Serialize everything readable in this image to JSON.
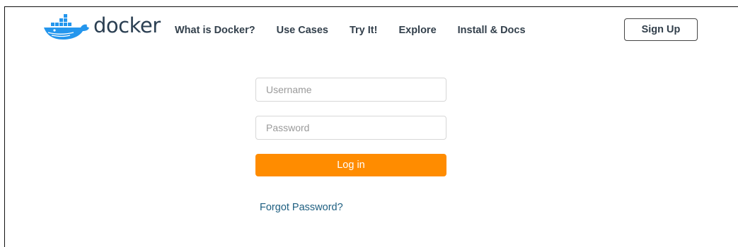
{
  "header": {
    "logo_text": "docker",
    "nav": [
      {
        "label": "What is Docker?"
      },
      {
        "label": "Use Cases"
      },
      {
        "label": "Try It!"
      },
      {
        "label": "Explore"
      },
      {
        "label": "Install & Docs"
      }
    ],
    "signup_label": "Sign Up"
  },
  "login_form": {
    "username_placeholder": "Username",
    "username_value": "",
    "password_placeholder": "Password",
    "password_value": "",
    "login_label": "Log in",
    "forgot_label": "Forgot Password?"
  },
  "colors": {
    "accent_orange": "#ff8c00",
    "logo_blue": "#2496ed",
    "logo_text": "#2b3f52",
    "link": "#1d5e80"
  },
  "icons": {
    "logo": "docker-whale-icon"
  }
}
